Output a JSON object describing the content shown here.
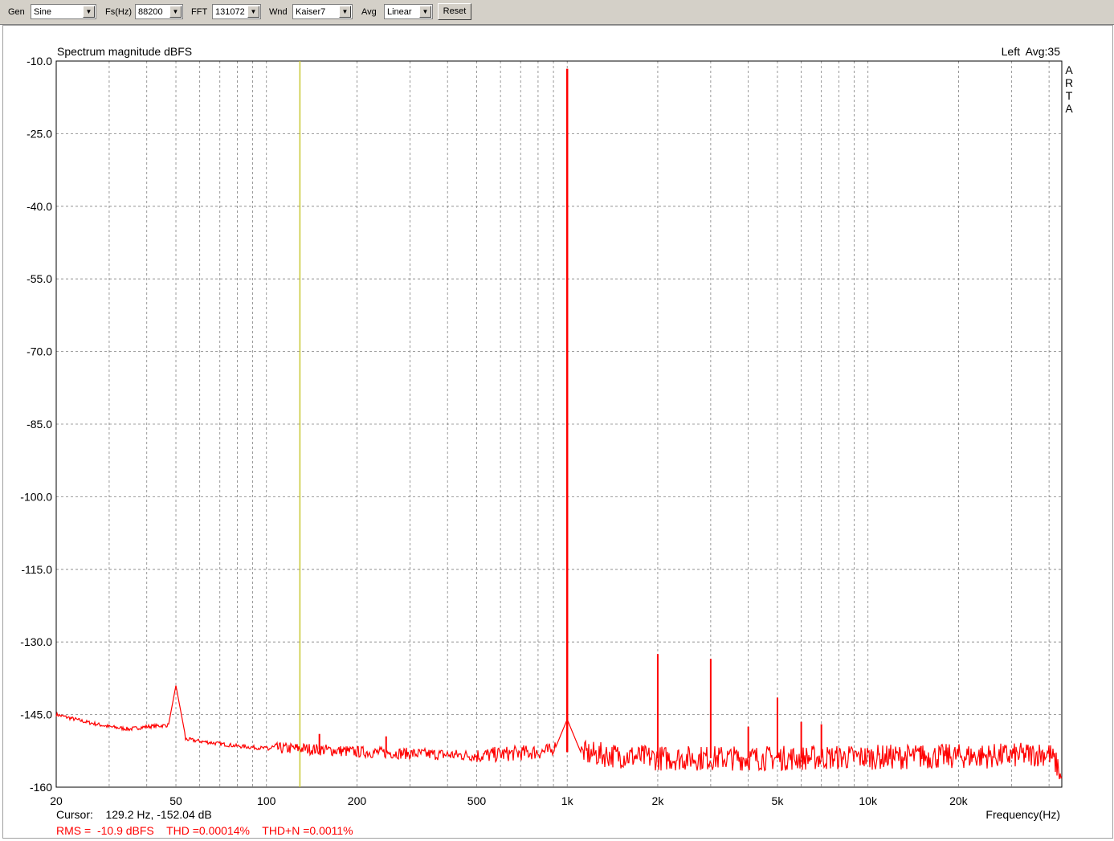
{
  "toolbar": {
    "gen_label": "Gen",
    "gen_value": "Sine",
    "fs_label": "Fs(Hz)",
    "fs_value": "88200",
    "fft_label": "FFT",
    "fft_value": "131072",
    "wnd_label": "Wnd",
    "wnd_value": "Kaiser7",
    "avg_label": "Avg",
    "avg_value": "Linear",
    "reset_label": "Reset"
  },
  "colors": {
    "trace": "#ff0000",
    "cursor": "#c8c832",
    "grid": "#808080",
    "toolbar_bg": "#d4d0c8"
  },
  "chart_data": {
    "type": "line",
    "title": "Spectrum magnitude dBFS",
    "channel": "Left",
    "avg_text": "Avg:35",
    "watermark": "ARTA",
    "xlabel": "Frequency(Hz)",
    "x_scale": "log",
    "xlim": [
      20,
      44100
    ],
    "ylim": [
      -160,
      -10
    ],
    "grid": true,
    "y_ticks": [
      -10,
      -25,
      -40,
      -55,
      -70,
      -85,
      -100,
      -115,
      -130,
      -145,
      -160
    ],
    "y_tick_labels": [
      "-10.0",
      "-25.0",
      "-40.0",
      "-55.0",
      "-70.0",
      "-85.0",
      "-100.0",
      "-115.0",
      "-130.0",
      "-145.0",
      "-160"
    ],
    "x_ticks": [
      20,
      50,
      100,
      200,
      500,
      1000,
      2000,
      5000,
      10000,
      20000
    ],
    "x_tick_labels": [
      "20",
      "50",
      "100",
      "200",
      "500",
      "1k",
      "2k",
      "5k",
      "10k",
      "20k"
    ],
    "cursor_freq": 129.2,
    "cursor_text": "Cursor:    129.2 Hz, -152.04 dB",
    "stats_text": "RMS =  -10.9 dBFS    THD =0.00014%    THD+N =0.0011%",
    "noise_floor": [
      [
        20,
        -145
      ],
      [
        25,
        -146.5
      ],
      [
        30,
        -147.5
      ],
      [
        35,
        -148
      ],
      [
        40,
        -147.5
      ],
      [
        47,
        -147.2
      ],
      [
        53,
        -150
      ],
      [
        60,
        -150.5
      ],
      [
        80,
        -151.5
      ],
      [
        100,
        -152
      ],
      [
        130,
        -152
      ],
      [
        200,
        -152.7
      ],
      [
        500,
        -153.5
      ],
      [
        900,
        -152.5
      ],
      [
        1100,
        -153
      ],
      [
        2000,
        -154
      ],
      [
        5000,
        -154
      ],
      [
        10000,
        -153.8
      ],
      [
        30000,
        -153.5
      ],
      [
        40000,
        -153
      ],
      [
        43000,
        -156
      ],
      [
        44100,
        -159
      ]
    ],
    "peaks": [
      {
        "f": 50,
        "db": -139
      },
      {
        "f": 150,
        "db": -149
      },
      {
        "f": 250,
        "db": -149.5
      },
      {
        "f": 1000,
        "db": -11.6
      },
      {
        "f": 2000,
        "db": -132.5
      },
      {
        "f": 3000,
        "db": -133.5
      },
      {
        "f": 4000,
        "db": -147.5
      },
      {
        "f": 5000,
        "db": -141.5
      },
      {
        "f": 6000,
        "db": -146.5
      },
      {
        "f": 7000,
        "db": -147
      },
      {
        "f": 15000,
        "db": -151.5
      }
    ]
  }
}
